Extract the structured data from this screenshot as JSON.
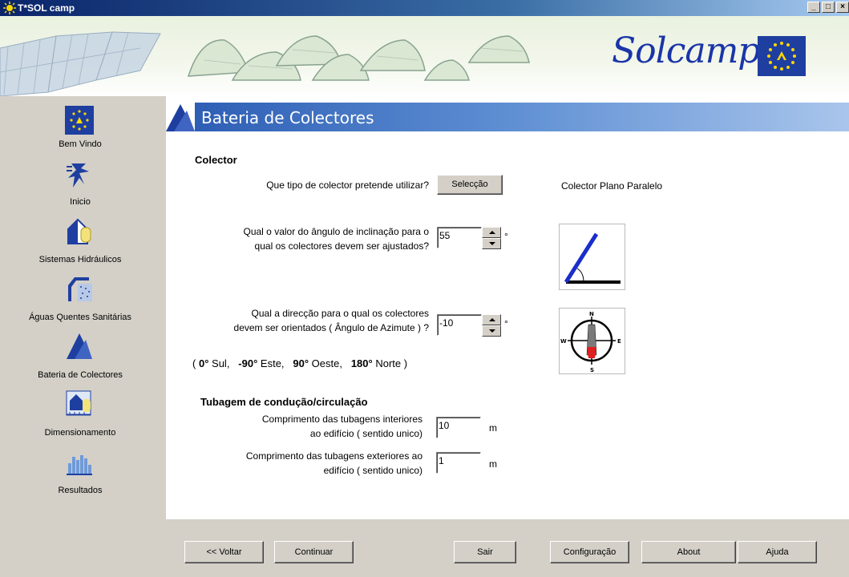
{
  "window": {
    "title": "T*SOL camp",
    "controls": [
      "_",
      "□",
      "×"
    ]
  },
  "banner": {
    "logo_text": "Solcamp"
  },
  "sidebar": {
    "items": [
      {
        "label": "Bem Vindo",
        "icon": "eu-stars-icon"
      },
      {
        "label": "Inicio",
        "icon": "runner-icon"
      },
      {
        "label": "Sistemas Hidráulicos",
        "icon": "house-tank-icon"
      },
      {
        "label": "Águas Quentes Sanitárias",
        "icon": "shower-icon"
      },
      {
        "label": "Bateria de Colectores",
        "icon": "collector-icon"
      },
      {
        "label": "Dimensionamento",
        "icon": "blueprint-icon"
      },
      {
        "label": "Resultados",
        "icon": "chart-icon"
      }
    ]
  },
  "page": {
    "title": "Bateria de Colectores"
  },
  "collector": {
    "section_title": "Colector",
    "type_question": "Que tipo de colector pretende utilizar?",
    "select_button": "Selecção",
    "selected_type": "Colector Plano Paralelo",
    "tilt_question_line1": "Qual o valor do ângulo de inclinação para o",
    "tilt_question_line2": "qual os colectores devem ser ajustados?",
    "tilt_value": "55",
    "tilt_unit": "°",
    "azimuth_question_line1": "Qual a direcção para o qual os colectores",
    "azimuth_question_line2": "devem ser orientados  ( Ângulo de Azimute )  ?",
    "azimuth_value": "-10",
    "azimuth_unit": "°",
    "azimuth_hint": {
      "open": "(",
      "v1": "0°",
      "t1": "Sul,",
      "v2": "-90°",
      "t2": "Este,",
      "v3": "90°",
      "t3": "Oeste,",
      "v4": "180°",
      "t4": "Norte",
      "close": ")"
    },
    "compass": {
      "n": "N",
      "s": "S",
      "e": "E",
      "w": "W"
    }
  },
  "piping": {
    "section_title": "Tubagem de condução/circulação",
    "interior_line1": "Comprimento das tubagens interiores",
    "interior_line2": "ao edifício   ( sentido unico)",
    "interior_value": "10",
    "interior_unit": "m",
    "exterior_line1": "Comprimento das tubagens exteriores ao",
    "exterior_line2": "edifício   ( sentido unico)",
    "exterior_value": "1",
    "exterior_unit": "m"
  },
  "footer": {
    "back": "<< Voltar",
    "continue": "Continuar",
    "exit": "Sair",
    "config": "Configuração",
    "about": "About",
    "help": "Ajuda"
  }
}
